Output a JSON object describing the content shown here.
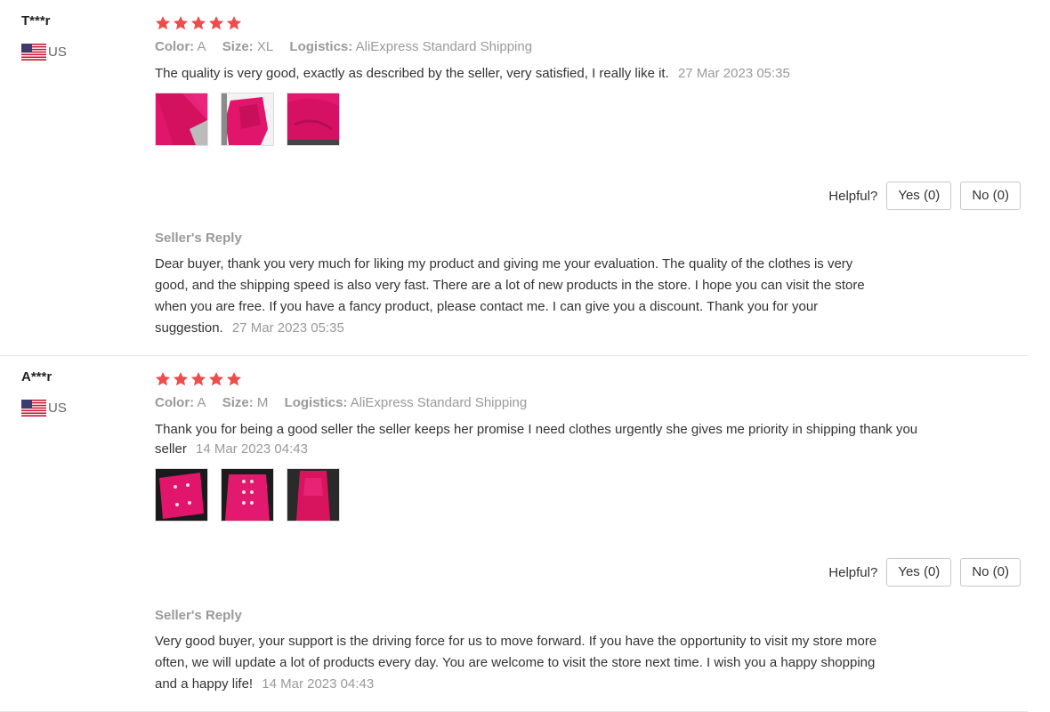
{
  "colors": {
    "star": "#ef4c4c",
    "muted": "#9a9a9a",
    "text": "#333333",
    "border": "#c8c8c8"
  },
  "reviews": [
    {
      "user": "T***r",
      "country": "US",
      "rating": 5,
      "meta": {
        "color_label": "Color:",
        "color_value": "A",
        "size_label": "Size:",
        "size_value": "XL",
        "logistics_label": "Logistics:",
        "logistics_value": "AliExpress Standard Shipping"
      },
      "text": "The quality is very good, exactly as described by the seller, very satisfied, I really like it.",
      "date": "27 Mar 2023 05:35",
      "helpful": {
        "label": "Helpful?",
        "yes": "Yes (0)",
        "no": "No (0)"
      },
      "reply": {
        "title": "Seller's Reply",
        "text": "Dear buyer, thank you very much for liking my product and giving me your evaluation. The quality of the clothes is very good, and the shipping speed is also very fast. There are a lot of new products in the store. I hope you can visit the store when you are free. If you have a fancy product, please contact me. I can give you a discount. Thank you for your suggestion.",
        "date": "27 Mar 2023 05:35"
      }
    },
    {
      "user": "A***r",
      "country": "US",
      "rating": 5,
      "meta": {
        "color_label": "Color:",
        "color_value": "A",
        "size_label": "Size:",
        "size_value": "M",
        "logistics_label": "Logistics:",
        "logistics_value": "AliExpress Standard Shipping"
      },
      "text": "Thank you for being a good seller the seller keeps her promise I need clothes urgently she gives me priority in shipping thank you seller",
      "date": "14 Mar 2023 04:43",
      "helpful": {
        "label": "Helpful?",
        "yes": "Yes (0)",
        "no": "No (0)"
      },
      "reply": {
        "title": "Seller's Reply",
        "text": "Very good buyer, your support is the driving force for us to move forward. If you have the opportunity to visit my store more often, we will update a lot of products every day. You are welcome to visit the store next time. I wish you a happy shopping and a happy life!",
        "date": "14 Mar 2023 04:43"
      }
    }
  ]
}
